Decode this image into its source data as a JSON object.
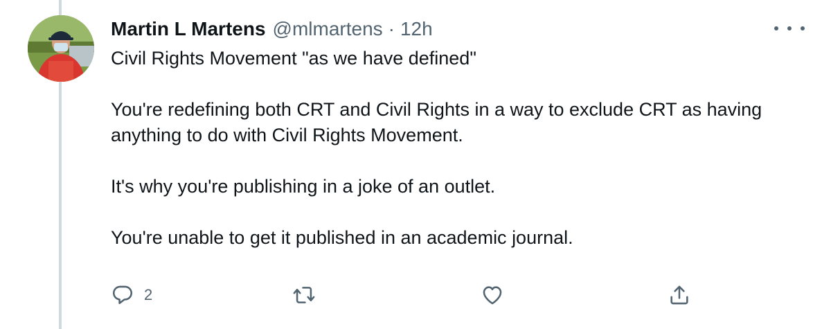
{
  "tweet": {
    "author_name": "Martin L Martens",
    "handle": "@mlmartens",
    "separator": "·",
    "time": "12h",
    "body": [
      "Civil Rights Movement \"as we have defined\"",
      "You're redefining both CRT and Civil Rights in a way to exclude CRT as having anything to do with Civil Rights Movement.",
      "It's why you're publishing in a joke of  an outlet.",
      "You're unable to get it published in an academic journal."
    ],
    "actions": {
      "reply_count": "2",
      "retweet_count": "",
      "like_count": "",
      "share_count": ""
    }
  },
  "icons": {
    "avatar": "user-avatar",
    "more": "more-options-icon",
    "reply": "reply-icon",
    "retweet": "retweet-icon",
    "like": "heart-icon",
    "share": "share-icon"
  },
  "colors": {
    "text_primary": "#0f1419",
    "text_secondary": "#536471",
    "thread_line": "#cfd9de",
    "background": "#ffffff"
  }
}
